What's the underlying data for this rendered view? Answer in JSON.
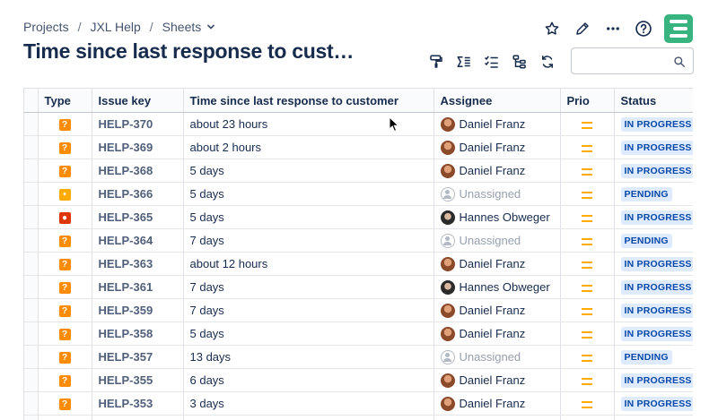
{
  "breadcrumb": [
    "Projects",
    "JXL Help",
    "Sheets"
  ],
  "page_title": "Time since last response to cust…",
  "search": {
    "placeholder": "",
    "value": ""
  },
  "columns": {
    "type": "Type",
    "key": "Issue key",
    "time": "Time since last response to customer",
    "assignee": "Assignee",
    "prio": "Prio",
    "status": "Status"
  },
  "colors": {
    "question": "#ff8b00",
    "idea": "#ffab00",
    "incident": "#de350b",
    "app_logo": "#36b37e",
    "priority_medium": "#ffab00"
  },
  "rows": [
    {
      "type": "question",
      "key": "HELP-370",
      "time": "about 23 hours",
      "assignee": "Daniel Franz",
      "avatar": "daniel",
      "status": "IN PROGRESS"
    },
    {
      "type": "question",
      "key": "HELP-369",
      "time": "about 2 hours",
      "assignee": "Daniel Franz",
      "avatar": "daniel",
      "status": "IN PROGRESS"
    },
    {
      "type": "question",
      "key": "HELP-368",
      "time": "5 days",
      "assignee": "Daniel Franz",
      "avatar": "daniel",
      "status": "IN PROGRESS"
    },
    {
      "type": "idea",
      "key": "HELP-366",
      "time": "5 days",
      "assignee": "Unassigned",
      "avatar": "none",
      "status": "PENDING"
    },
    {
      "type": "incident",
      "key": "HELP-365",
      "time": "5 days",
      "assignee": "Hannes Obweger",
      "avatar": "hannes",
      "status": "IN PROGRESS"
    },
    {
      "type": "question",
      "key": "HELP-364",
      "time": "7 days",
      "assignee": "Unassigned",
      "avatar": "none",
      "status": "PENDING"
    },
    {
      "type": "question",
      "key": "HELP-363",
      "time": "about 12 hours",
      "assignee": "Daniel Franz",
      "avatar": "daniel",
      "status": "IN PROGRESS"
    },
    {
      "type": "question",
      "key": "HELP-361",
      "time": "7 days",
      "assignee": "Hannes Obweger",
      "avatar": "hannes",
      "status": "IN PROGRESS"
    },
    {
      "type": "question",
      "key": "HELP-359",
      "time": "7 days",
      "assignee": "Daniel Franz",
      "avatar": "daniel",
      "status": "IN PROGRESS"
    },
    {
      "type": "question",
      "key": "HELP-358",
      "time": "5 days",
      "assignee": "Daniel Franz",
      "avatar": "daniel",
      "status": "IN PROGRESS"
    },
    {
      "type": "question",
      "key": "HELP-357",
      "time": "13 days",
      "assignee": "Unassigned",
      "avatar": "none",
      "status": "PENDING"
    },
    {
      "type": "question",
      "key": "HELP-355",
      "time": "6 days",
      "assignee": "Daniel Franz",
      "avatar": "daniel",
      "status": "IN PROGRESS"
    },
    {
      "type": "question",
      "key": "HELP-353",
      "time": "3 days",
      "assignee": "Daniel Franz",
      "avatar": "daniel",
      "status": "IN PROGRESS"
    },
    {
      "type": "question",
      "key": "",
      "time": "",
      "assignee": "",
      "avatar": "none",
      "status": ""
    }
  ]
}
